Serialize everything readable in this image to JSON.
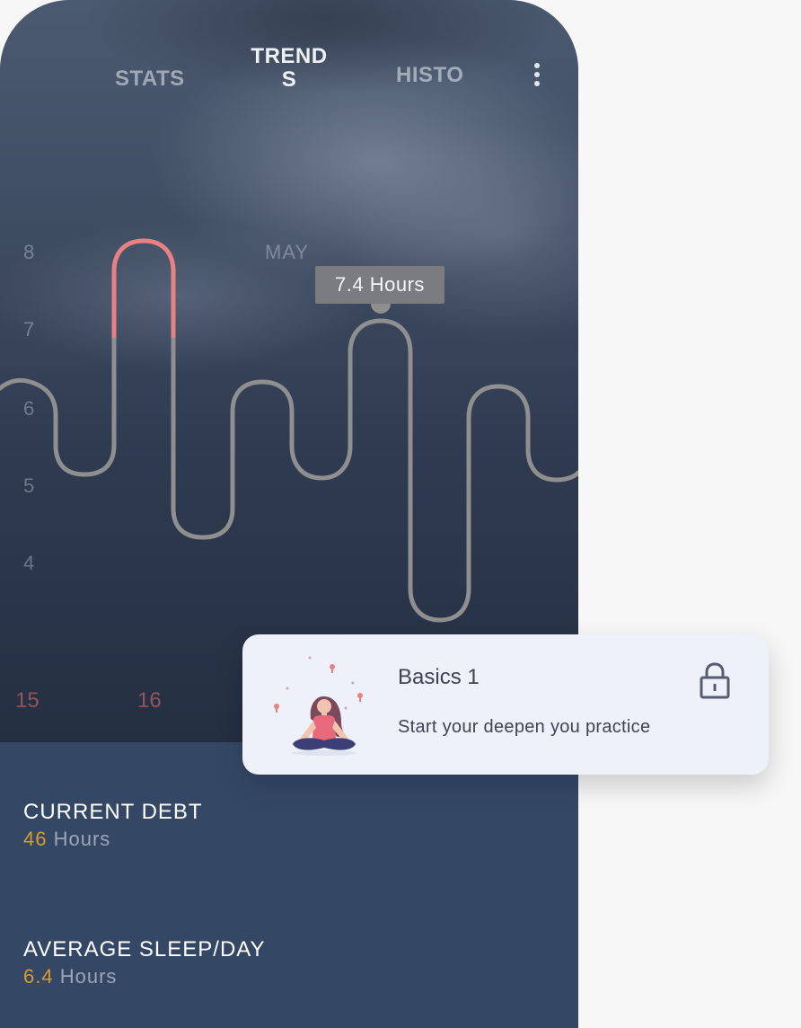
{
  "tabs": [
    {
      "label": "STATS"
    },
    {
      "label": "TREND S"
    },
    {
      "label": "HISTO"
    }
  ],
  "icons": {
    "menu": "more-vert-icon",
    "lock": "lock-icon",
    "illustration": "meditation-illustration"
  },
  "chart_data": {
    "type": "line",
    "month_label": "MAY",
    "y_ticks": [
      "8",
      "7",
      "6",
      "5",
      "4"
    ],
    "x_ticks": [
      "15",
      "16"
    ],
    "tooltip": "7.4 Hours",
    "colors": {
      "line": "#8f8f8f",
      "highlight": "#e88282"
    }
  },
  "stats": {
    "debt": {
      "label": "CURRENT DEBT",
      "value": "46",
      "unit": "Hours"
    },
    "average": {
      "label": "AVERAGE SLEEP/DAY",
      "value": "6.4",
      "unit": "Hours"
    }
  },
  "card": {
    "title": "Basics 1",
    "subtitle": "Start your deepen you practice"
  },
  "colors": {
    "accent": "#d89a2c",
    "panel": "#344866",
    "card_bg": "#eef0fa"
  }
}
